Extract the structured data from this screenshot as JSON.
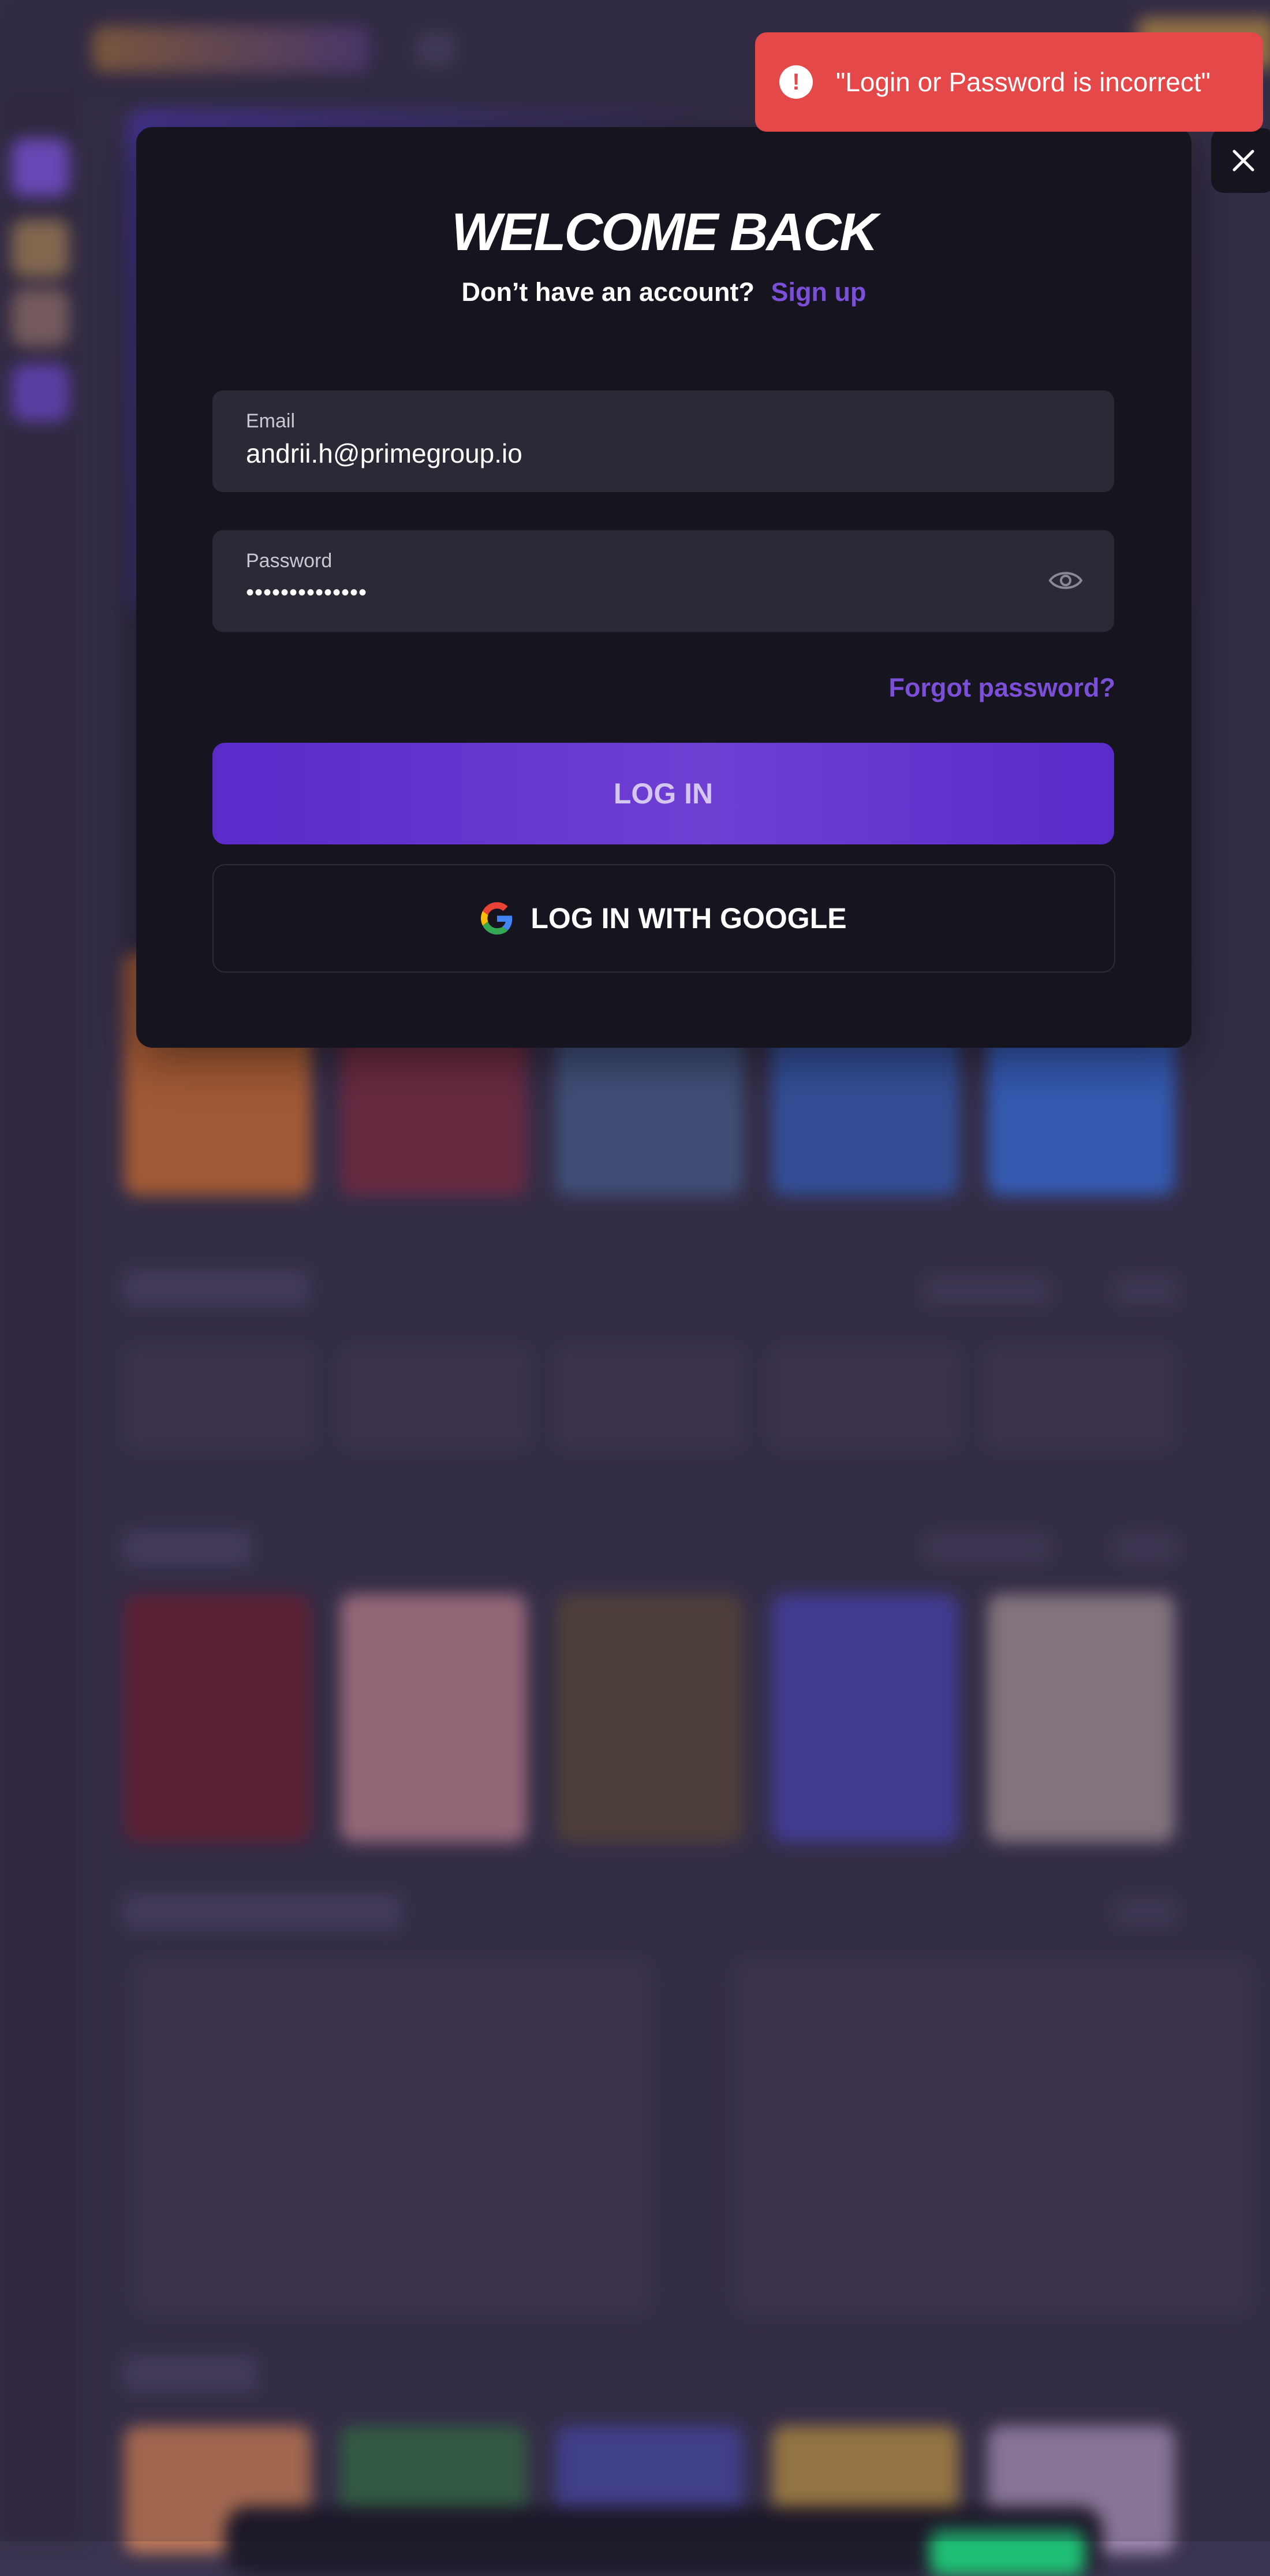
{
  "toast": {
    "message": "\"Login or Password is incorrect\"",
    "icon": "alert-circle-icon"
  },
  "modal": {
    "title": "WELCOME BACK",
    "subtitle_question": "Don’t have an account?",
    "signup_link": "Sign up",
    "email": {
      "label": "Email",
      "value": "andrii.h@primegroup.io"
    },
    "password": {
      "label": "Password",
      "masked_value": "••••••••••••••",
      "icon": "eye-icon"
    },
    "forgot_password": "Forgot password?",
    "login_button": "LOG IN",
    "google_button": "LOG IN WITH GOOGLE",
    "close_icon": "close-icon"
  },
  "colors": {
    "accent_purple": "#7b4fd8",
    "button_purple": "#5a2bc9",
    "modal_bg": "#16141f",
    "field_bg": "#2b2936",
    "error_red": "#e54848",
    "page_bg": "#3b3450"
  }
}
